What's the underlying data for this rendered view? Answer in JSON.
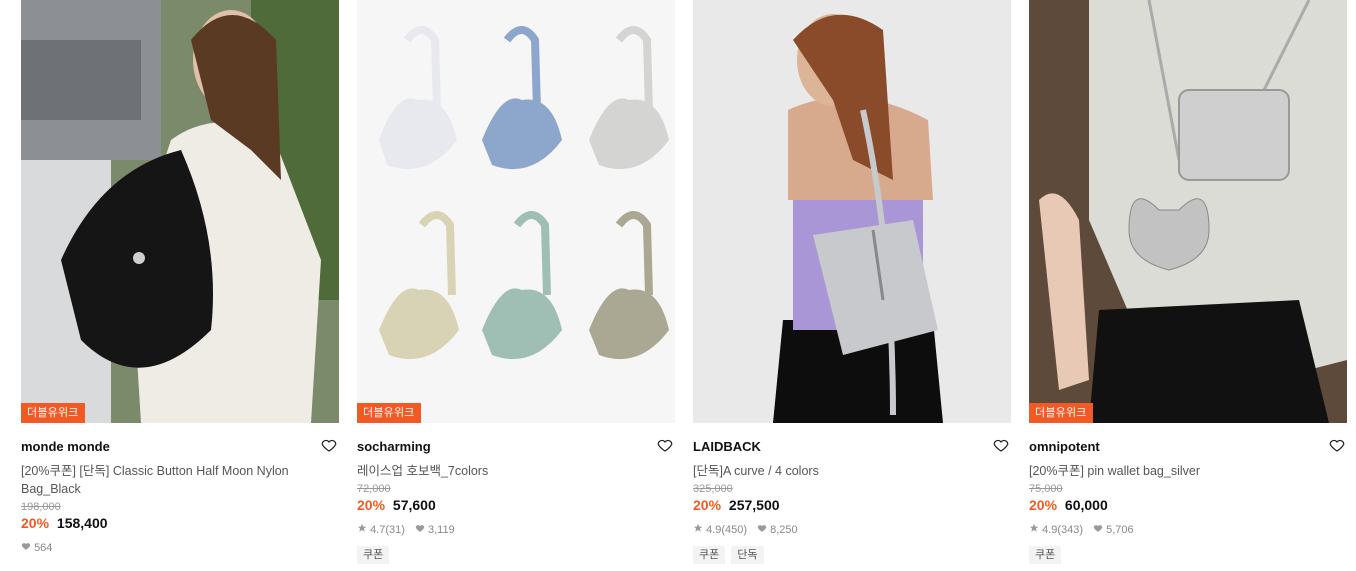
{
  "products": [
    {
      "badge": "더블유위크",
      "brand": "monde monde",
      "title": "[20%쿠폰] [단독] Classic Button Half Moon Nylon Bag_Black",
      "original_price": "198,000",
      "discount": "20%",
      "price": "158,400",
      "likes": "564",
      "rating": "",
      "reviews": "",
      "tags": []
    },
    {
      "badge": "더블유위크",
      "brand": "socharming",
      "title": "레이스업 호보백_7colors",
      "original_price": "72,000",
      "discount": "20%",
      "price": "57,600",
      "rating": "4.7",
      "reviews": "(31)",
      "likes": "3,119",
      "tags": [
        "쿠폰"
      ]
    },
    {
      "badge": "",
      "brand": "LAIDBACK",
      "title": "[단독]A curve / 4 colors",
      "original_price": "325,000",
      "discount": "20%",
      "price": "257,500",
      "rating": "4.9",
      "reviews": "(450)",
      "likes": "8,250",
      "tags": [
        "쿠폰",
        "단독"
      ]
    },
    {
      "badge": "더블유위크",
      "brand": "omnipotent",
      "title": "[20%쿠폰] pin wallet bag_silver",
      "original_price": "75,000",
      "discount": "20%",
      "price": "60,000",
      "rating": "4.9",
      "reviews": "(343)",
      "likes": "5,706",
      "tags": [
        "쿠폰"
      ]
    }
  ],
  "colors": {
    "accent": "#f15a24",
    "star": "#999999",
    "heart_meta": "#999999"
  },
  "icons": {
    "wishlist": "heart-outline-icon",
    "rating": "star-icon",
    "likes": "heart-icon"
  }
}
